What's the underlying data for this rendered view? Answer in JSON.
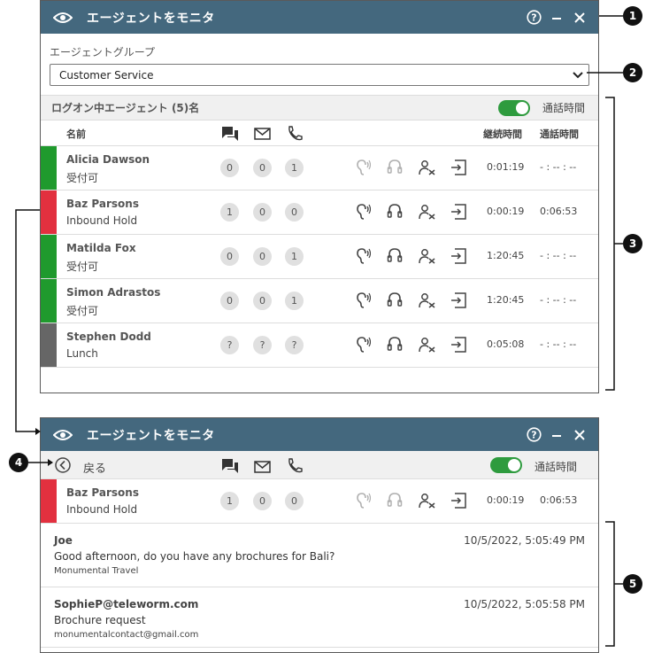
{
  "panel1": {
    "title": "エージェントをモニタ",
    "group_label": "エージェントグループ",
    "group_value": "Customer Service",
    "section_title": "ログオン中エージェント (5)名",
    "toggle_label": "通話時間",
    "headers": {
      "name": "名前",
      "duration": "継続時間",
      "talk_time": "通話時間"
    },
    "agents": [
      {
        "name": "Alicia Dawson",
        "status": "受付可",
        "status_color": "#1f9a2d",
        "counts": [
          "0",
          "0",
          "1"
        ],
        "duration": "0:01:19",
        "talk_time": "- : -- : --"
      },
      {
        "name": "Baz Parsons",
        "status": "Inbound Hold",
        "status_color": "#e2303f",
        "counts": [
          "1",
          "0",
          "0"
        ],
        "duration": "0:00:19",
        "talk_time": "0:06:53"
      },
      {
        "name": "Matilda Fox",
        "status": "受付可",
        "status_color": "#1f9a2d",
        "counts": [
          "0",
          "0",
          "1"
        ],
        "duration": "1:20:45",
        "talk_time": "- : -- : --"
      },
      {
        "name": "Simon Adrastos",
        "status": "受付可",
        "status_color": "#1f9a2d",
        "counts": [
          "0",
          "0",
          "1"
        ],
        "duration": "1:20:45",
        "talk_time": "- : -- : --"
      },
      {
        "name": "Stephen Dodd",
        "status": "Lunch",
        "status_color": "#666666",
        "counts": [
          "?",
          "?",
          "?"
        ],
        "duration": "0:05:08",
        "talk_time": "- : -- : --"
      }
    ]
  },
  "panel2": {
    "title": "エージェントをモニタ",
    "back_label": "戻る",
    "toggle_label": "通話時間",
    "agent": {
      "name": "Baz Parsons",
      "status": "Inbound Hold",
      "status_color": "#e2303f",
      "counts": [
        "1",
        "0",
        "0"
      ],
      "duration": "0:00:19",
      "talk_time": "0:06:53"
    },
    "messages": [
      {
        "from": "Joe",
        "timestamp": "10/5/2022, 5:05:49 PM",
        "subject": "Good afternoon, do you have any brochures for Bali?",
        "org": "Monumental Travel"
      },
      {
        "from": "SophieP@teleworm.com",
        "timestamp": "10/5/2022, 5:05:58 PM",
        "subject": "Brochure request",
        "org": "monumentalcontact@gmail.com"
      }
    ]
  },
  "callouts": [
    "1",
    "2",
    "3",
    "4",
    "5"
  ],
  "colors": {
    "titlebar": "#44687e",
    "toggle_on": "#2e9b3e",
    "available": "#1f9a2d",
    "hold": "#e2303f",
    "away": "#666666"
  }
}
